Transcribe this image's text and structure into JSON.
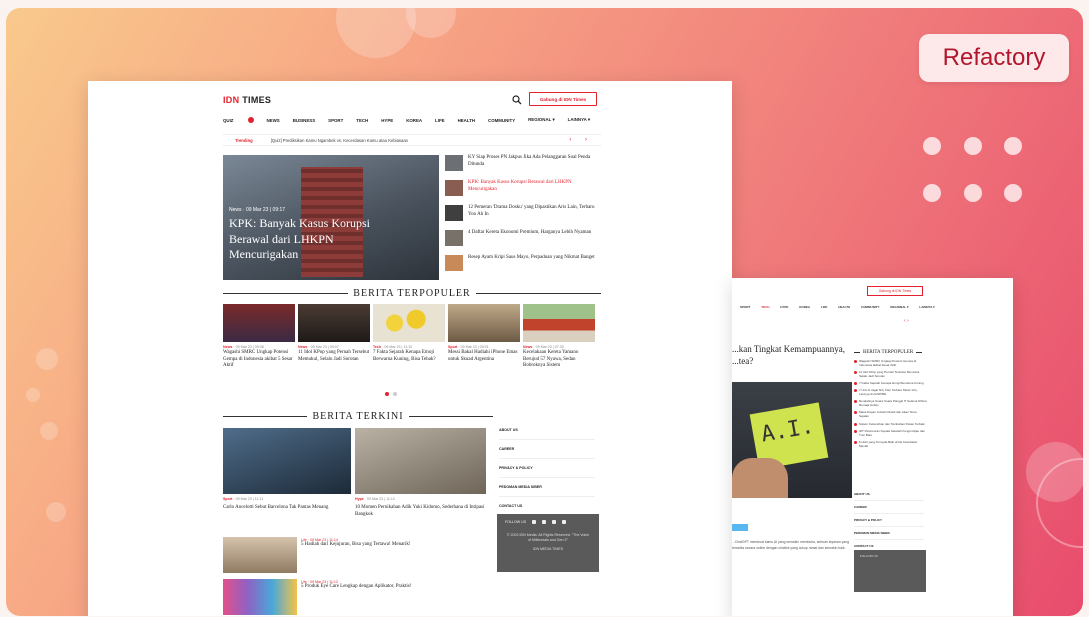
{
  "badge": {
    "label": "Refactory"
  },
  "site": {
    "logo_idn": "IDN",
    "logo_times": "TIMES",
    "join_label": "Gabung di IDN Times",
    "nav": [
      "QUIZ",
      "NEWS",
      "BUSINESS",
      "SPORT",
      "TECH",
      "HYPE",
      "KOREA",
      "LIFE",
      "HEALTH",
      "COMMUNITY",
      "REGIONAL ▾",
      "LAINNYA ▾"
    ],
    "trending_label": "Trending",
    "trending_text": "[Quiz] Prediksikan Kamu Ngambek vs. Kecerdasan Kamu atau Kebiasaan",
    "hero": {
      "tag": "News · 09 Mar 23 | 09:17",
      "title": "KPK: Banyak Kasus Korupsi Berawal dari LHKPN Mencurigakan"
    },
    "side_news": [
      {
        "title": "KY Siap Proses PN Jakpus Jika Ada Pelanggaran Soal Penda Ditunda",
        "red": false
      },
      {
        "title": "KPK: Banyak Kasus Korupsi Berawal dari LHKPN Mencurigakan",
        "red": true
      },
      {
        "title": "12 Pemeran 'Drama Dosku' yang Dipastikan Aris Lain, Terbaru Yoo Ah In",
        "red": false
      },
      {
        "title": "4 Daftar Kereta Ekonomi Premium, Harganya Lebih Nyaman",
        "red": false
      },
      {
        "title": "Resep Ayam Kripi Saus Mayo, Perpaduan yang Nikmat Banget",
        "red": false
      }
    ],
    "popular_heading": "BERITA TERPOPULER",
    "popular": [
      {
        "cat": "News",
        "date": "09 Mar 23 | 09:08",
        "title": "Wagashi SMRC Ungkap Potensi Gempa di Indonesia akibat 5 Sesar Aktif"
      },
      {
        "cat": "News",
        "date": "09 Mar 23 | 09:07",
        "title": "11 Idol KPop yang Pernah Tersebut Memukul, Selalu Jadi Sorotan"
      },
      {
        "cat": "Tech",
        "date": "09 Mar 23 | 11:10",
        "title": "7 Fakta Sejarah Kenapa Emoji Berwarna Kuning, Bisa Tebak?"
      },
      {
        "cat": "Sport",
        "date": "09 Mar 23 | 09:01",
        "title": "Messi Bakal Hadiahi iPhone Emas untuk Skuad Argentina"
      },
      {
        "cat": "News",
        "date": "09 Mar 23 | 07:30",
        "title": "Kecelakaan Kereta Yamano Berujud 57 Nyawa, Sedan Bobroknya Sistem"
      }
    ],
    "latest_heading": "BERITA TERKINI",
    "latest": [
      {
        "cat": "Sport",
        "date": "09 Mar 23 | 11:11",
        "title": "Carlo Ancelotti Sebut Barcelona Tak Pantas Menang"
      },
      {
        "cat": "Hype",
        "date": "09 Mar 23 | 11:12",
        "title": "10 Momen Pernikahan Adik Yuki Kidomo, Sederhana di Intipasi Bangkok"
      }
    ],
    "small_news": [
      {
        "cat": "Life",
        "date": "09 Mar 23 | 11:14",
        "title": "5 Hadiah dari Kejujuran, Bisa yang Tertawa! Menarik!"
      },
      {
        "cat": "Life",
        "date": "09 Mar 23 | 11:13",
        "title": "5 Produk Eye Care Lengkap dengan Aplikator, Praktis!"
      }
    ],
    "footer_links": [
      "ABOUT US",
      "CAREER",
      "PRIVACY & POLICY",
      "PEDOMAN MEDIA SIBER",
      "CONTACT US"
    ],
    "follow_label": "FOLLOW US",
    "copyright": "© 2023 IDN Media. All Rights Reserved. \"The Voice of Millennials and Gen Z\"",
    "copyright2": "IDN MEDIA TIMES"
  },
  "page2": {
    "join_label": "Gabung di IDN Times",
    "nav": [
      "SPORT",
      "TECH",
      "HYPE",
      "KOREA",
      "LIFE",
      "HEALTH",
      "COMMUNITY",
      "REGIONAL ▾",
      "LAINNYA ▾"
    ],
    "headline": "...kan Tingkat Kemampuannya, ...tea?",
    "trending_title": "BERITA TERPOPULER",
    "trending_items": [
      "Wagashi SMRC Ungkap Potensi Gempa di Indonesia akibat Sesar Aktif",
      "11 Idol KPop yang Pernah Tersebut Memukul, Selalu Jadi Sorotan",
      "7 Fakta Sejarah Kenapa Emoji Berwarna Kuning",
      "7 Unit di Jagat Nih, Fitur Terbaru Music Info, Lainnya di ArtSPIRE",
      "Rendahnya Suara Suara Panggil IT Selama Dihina Remaja Hobby",
      "Masa Depan Industri Musik dan Akan Terus Sejalan",
      "Sistem Kebersihan dan Tambahan Pekan Terbaik",
      "IDT Peluncuran Kepala Sekolah Fungsi Hijau dan Tren Baru",
      "5 Hobi yang Ternyata Baik untuk Kesehatan Mental"
    ],
    "links": [
      "ABOUT US",
      "CAREER",
      "PRIVACY & POLICY",
      "PEDOMAN MEDIA SIBER",
      "CONTACT US"
    ],
    "follow_label": "FOLLOW US",
    "body": "...ChatGPT membuat kamu AI yang semakin membuka, sebuah layanan yang tersedia secara online dengan chatbot yang cukup ramai dan semakin baik."
  }
}
